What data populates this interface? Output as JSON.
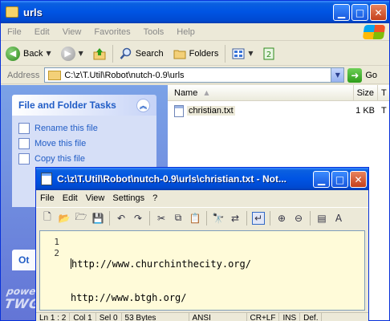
{
  "explorer": {
    "title": "urls",
    "menu": [
      "File",
      "Edit",
      "View",
      "Favorites",
      "Tools",
      "Help"
    ],
    "toolbar": {
      "back_label": "Back",
      "search_label": "Search",
      "folders_label": "Folders"
    },
    "address": {
      "label": "Address",
      "value": "C:\\z\\T.Util\\Robot\\nutch-0.9\\urls",
      "go_label": "Go"
    },
    "tasks": {
      "title": "File and Folder Tasks",
      "items": [
        {
          "label": "Rename this file",
          "icon": "rename-icon"
        },
        {
          "label": "Move this file",
          "icon": "move-icon"
        },
        {
          "label": "Copy this file",
          "icon": "copy-icon"
        }
      ]
    },
    "other_title": "Ot",
    "watermark": {
      "line1": "powered by",
      "line2": "TWG"
    },
    "columns": {
      "name": "Name",
      "size": "Size",
      "type": "T"
    },
    "files": [
      {
        "name": "christian.txt",
        "size": "1 KB",
        "type": "T"
      }
    ]
  },
  "notepad": {
    "title": "C:\\z\\T.Util\\Robot\\nutch-0.9\\urls\\christian.txt - Not...",
    "menu": [
      "File",
      "Edit",
      "View",
      "Settings",
      "?"
    ],
    "lines": [
      {
        "num": "1",
        "text": "http://www.churchinthecity.org/"
      },
      {
        "num": "2",
        "text": "http://www.btgh.org/"
      }
    ],
    "status": {
      "position": "Ln 1 : 2",
      "column": "Col 1",
      "selection": "Sel 0",
      "bytes": "53 Bytes",
      "encoding": "ANSI",
      "line_ending": "CR+LF",
      "insert": "INS",
      "scheme": "Def."
    }
  },
  "colors": {
    "titlebar": "#0054e3",
    "taskpane": "#7ba2e7",
    "task_link": "#215dc6",
    "editor_bg": "#fffbd9"
  }
}
